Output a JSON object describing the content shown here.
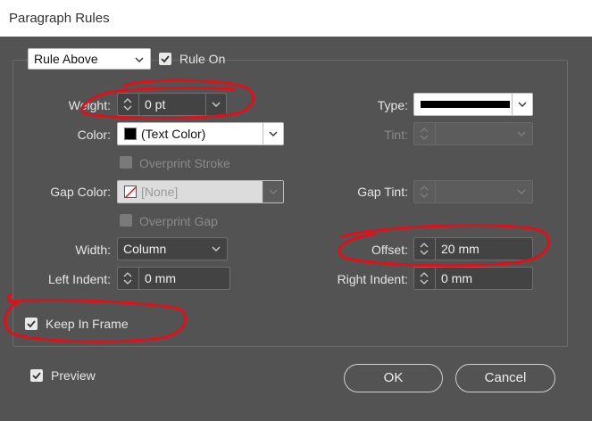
{
  "window": {
    "title": "Paragraph Rules"
  },
  "rule_select": {
    "value": "Rule Above"
  },
  "rule_on": {
    "label": "Rule On",
    "checked": true
  },
  "weight": {
    "label": "Weight:",
    "value": "0 pt"
  },
  "type": {
    "label": "Type:"
  },
  "color": {
    "label": "Color:",
    "value": "(Text Color)"
  },
  "tint": {
    "label": "Tint:"
  },
  "overprint_stroke": {
    "label": "Overprint Stroke",
    "enabled": false
  },
  "gap_color": {
    "label": "Gap Color:",
    "value": "[None]"
  },
  "gap_tint": {
    "label": "Gap Tint:"
  },
  "overprint_gap": {
    "label": "Overprint Gap",
    "enabled": false
  },
  "width": {
    "label": "Width:",
    "value": "Column"
  },
  "offset": {
    "label": "Offset:",
    "value": "20 mm"
  },
  "left_indent": {
    "label": "Left Indent:",
    "value": "0 mm"
  },
  "right_indent": {
    "label": "Right Indent:",
    "value": "0 mm"
  },
  "keep_in_frame": {
    "label": "Keep In Frame",
    "checked": true
  },
  "preview": {
    "label": "Preview",
    "checked": true
  },
  "buttons": {
    "ok": "OK",
    "cancel": "Cancel"
  },
  "colors": {
    "panel": "#535353",
    "annotation": "#e0101a"
  }
}
